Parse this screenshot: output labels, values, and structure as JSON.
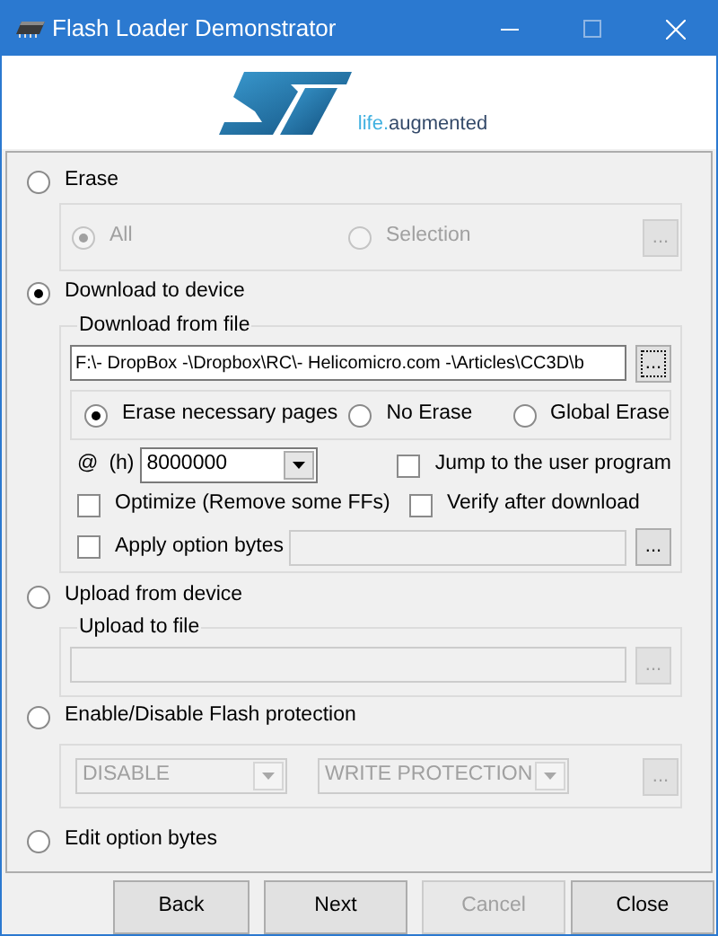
{
  "window": {
    "title": "Flash Loader Demonstrator"
  },
  "branding": {
    "tagline_prefix": "life.",
    "tagline_suffix": "augmented"
  },
  "operations": [
    {
      "kind": "erase",
      "label": "Erase",
      "selected": false,
      "options": [
        {
          "label": "All",
          "selected": true,
          "disabled": true
        },
        {
          "label": "Selection",
          "selected": false,
          "disabled": true
        }
      ],
      "browse": {
        "label": "...",
        "disabled": true
      }
    },
    {
      "kind": "download",
      "label": "Download to device",
      "selected": true,
      "group_title": "Download from file",
      "file_path": "F:\\- DropBox -\\Dropbox\\RC\\- Helicomicro.com -\\Articles\\CC3D\\b",
      "browse": {
        "label": "...",
        "disabled": false,
        "focused": true
      },
      "erase_modes": [
        {
          "label": "Erase necessary pages",
          "selected": true
        },
        {
          "label": "No Erase",
          "selected": false
        },
        {
          "label": "Global Erase",
          "selected": false
        }
      ],
      "address_symbol": "@",
      "address_unit": "(h)",
      "address": "8000000",
      "jump_to_user_program": {
        "label": "Jump to the user program",
        "checked": false
      },
      "optimize": {
        "label": "Optimize (Remove some FFs)",
        "checked": false
      },
      "verify": {
        "label": "Verify after download",
        "checked": false
      },
      "apply_option_bytes": {
        "label": "Apply option bytes",
        "checked": false,
        "field_disabled": true,
        "browse": {
          "label": "...",
          "disabled": false
        }
      }
    },
    {
      "kind": "upload",
      "label": "Upload from device",
      "selected": false,
      "group_title": "Upload to file",
      "field_disabled": true,
      "browse": {
        "label": "...",
        "disabled": true
      }
    },
    {
      "kind": "protection",
      "label": "Enable/Disable Flash protection",
      "selected": false,
      "mode": {
        "value": "DISABLE",
        "disabled": true
      },
      "type": {
        "value": "WRITE PROTECTION",
        "disabled": true
      },
      "browse": {
        "label": "...",
        "disabled": true
      }
    },
    {
      "kind": "edit_option_bytes",
      "label": "Edit option bytes",
      "selected": false
    }
  ],
  "buttons": [
    {
      "label": "Back",
      "disabled": false
    },
    {
      "label": "Next",
      "disabled": false
    },
    {
      "label": "Cancel",
      "disabled": true
    },
    {
      "label": "Close",
      "disabled": false
    }
  ]
}
